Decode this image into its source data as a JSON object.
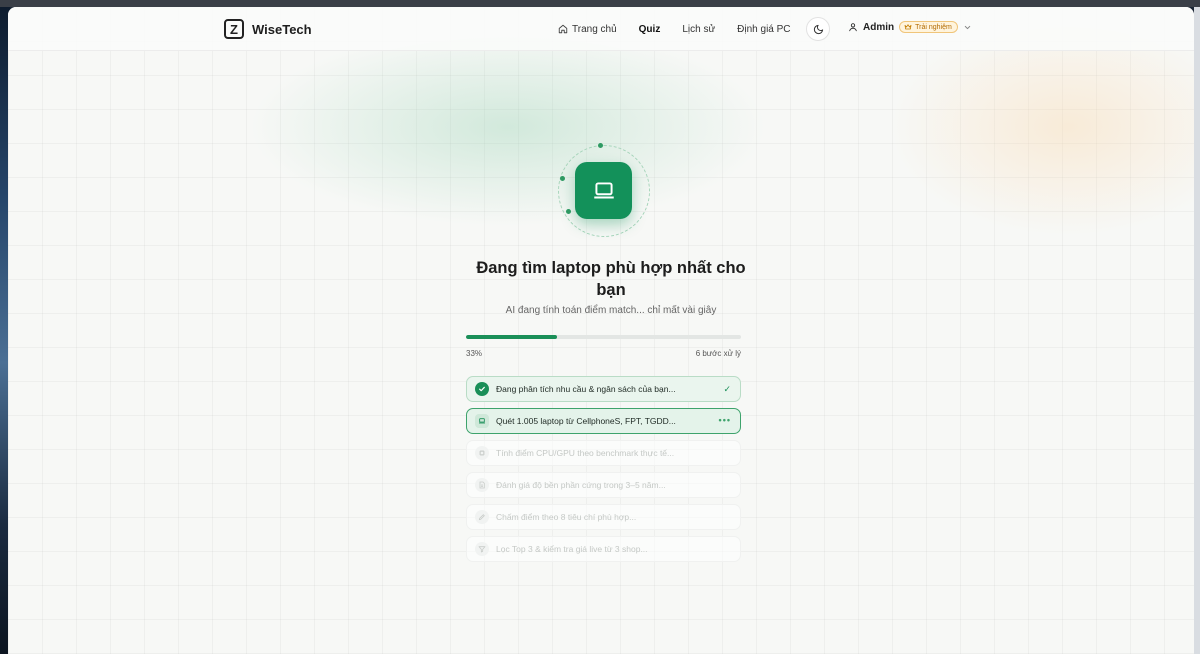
{
  "brand": {
    "name": "WiseTech",
    "logo_letter": "Z"
  },
  "nav": {
    "items": [
      {
        "label": "Trang chủ",
        "icon": "home-icon"
      },
      {
        "label": "Quiz"
      },
      {
        "label": "Lịch sử"
      },
      {
        "label": "Định giá PC"
      }
    ],
    "active": "Quiz"
  },
  "user": {
    "name": "Admin",
    "badge": "Trải nghiệm"
  },
  "loading": {
    "title": "Đang tìm laptop phù hợp nhất cho bạn",
    "subtitle": "AI đang tính toán điểm match... chỉ mất vài giây",
    "progress_label": "33%",
    "progress_value": 0.33,
    "steps_label": "6 bước xử lý"
  },
  "steps": [
    {
      "label": "Đang phân tích nhu cầu & ngân sách của bạn...",
      "status": "done",
      "icon": "check-icon"
    },
    {
      "label": "Quét 1.005 laptop từ CellphoneS, FPT, TGDD...",
      "status": "active",
      "icon": "laptop-icon"
    },
    {
      "label": "Tính điểm CPU/GPU theo benchmark thực tế...",
      "status": "pending",
      "icon": "chip-icon"
    },
    {
      "label": "Đánh giá độ bền phần cứng trong 3–5 năm...",
      "status": "pending",
      "icon": "document-icon"
    },
    {
      "label": "Chấm điểm theo 8 tiêu chí phù hợp...",
      "status": "pending",
      "icon": "pen-icon"
    },
    {
      "label": "Lọc Top 3 & kiểm tra giá live từ 3 shop...",
      "status": "pending",
      "icon": "filter-icon"
    }
  ],
  "colors": {
    "accent": "#13915a",
    "badge": "#b26a00"
  }
}
